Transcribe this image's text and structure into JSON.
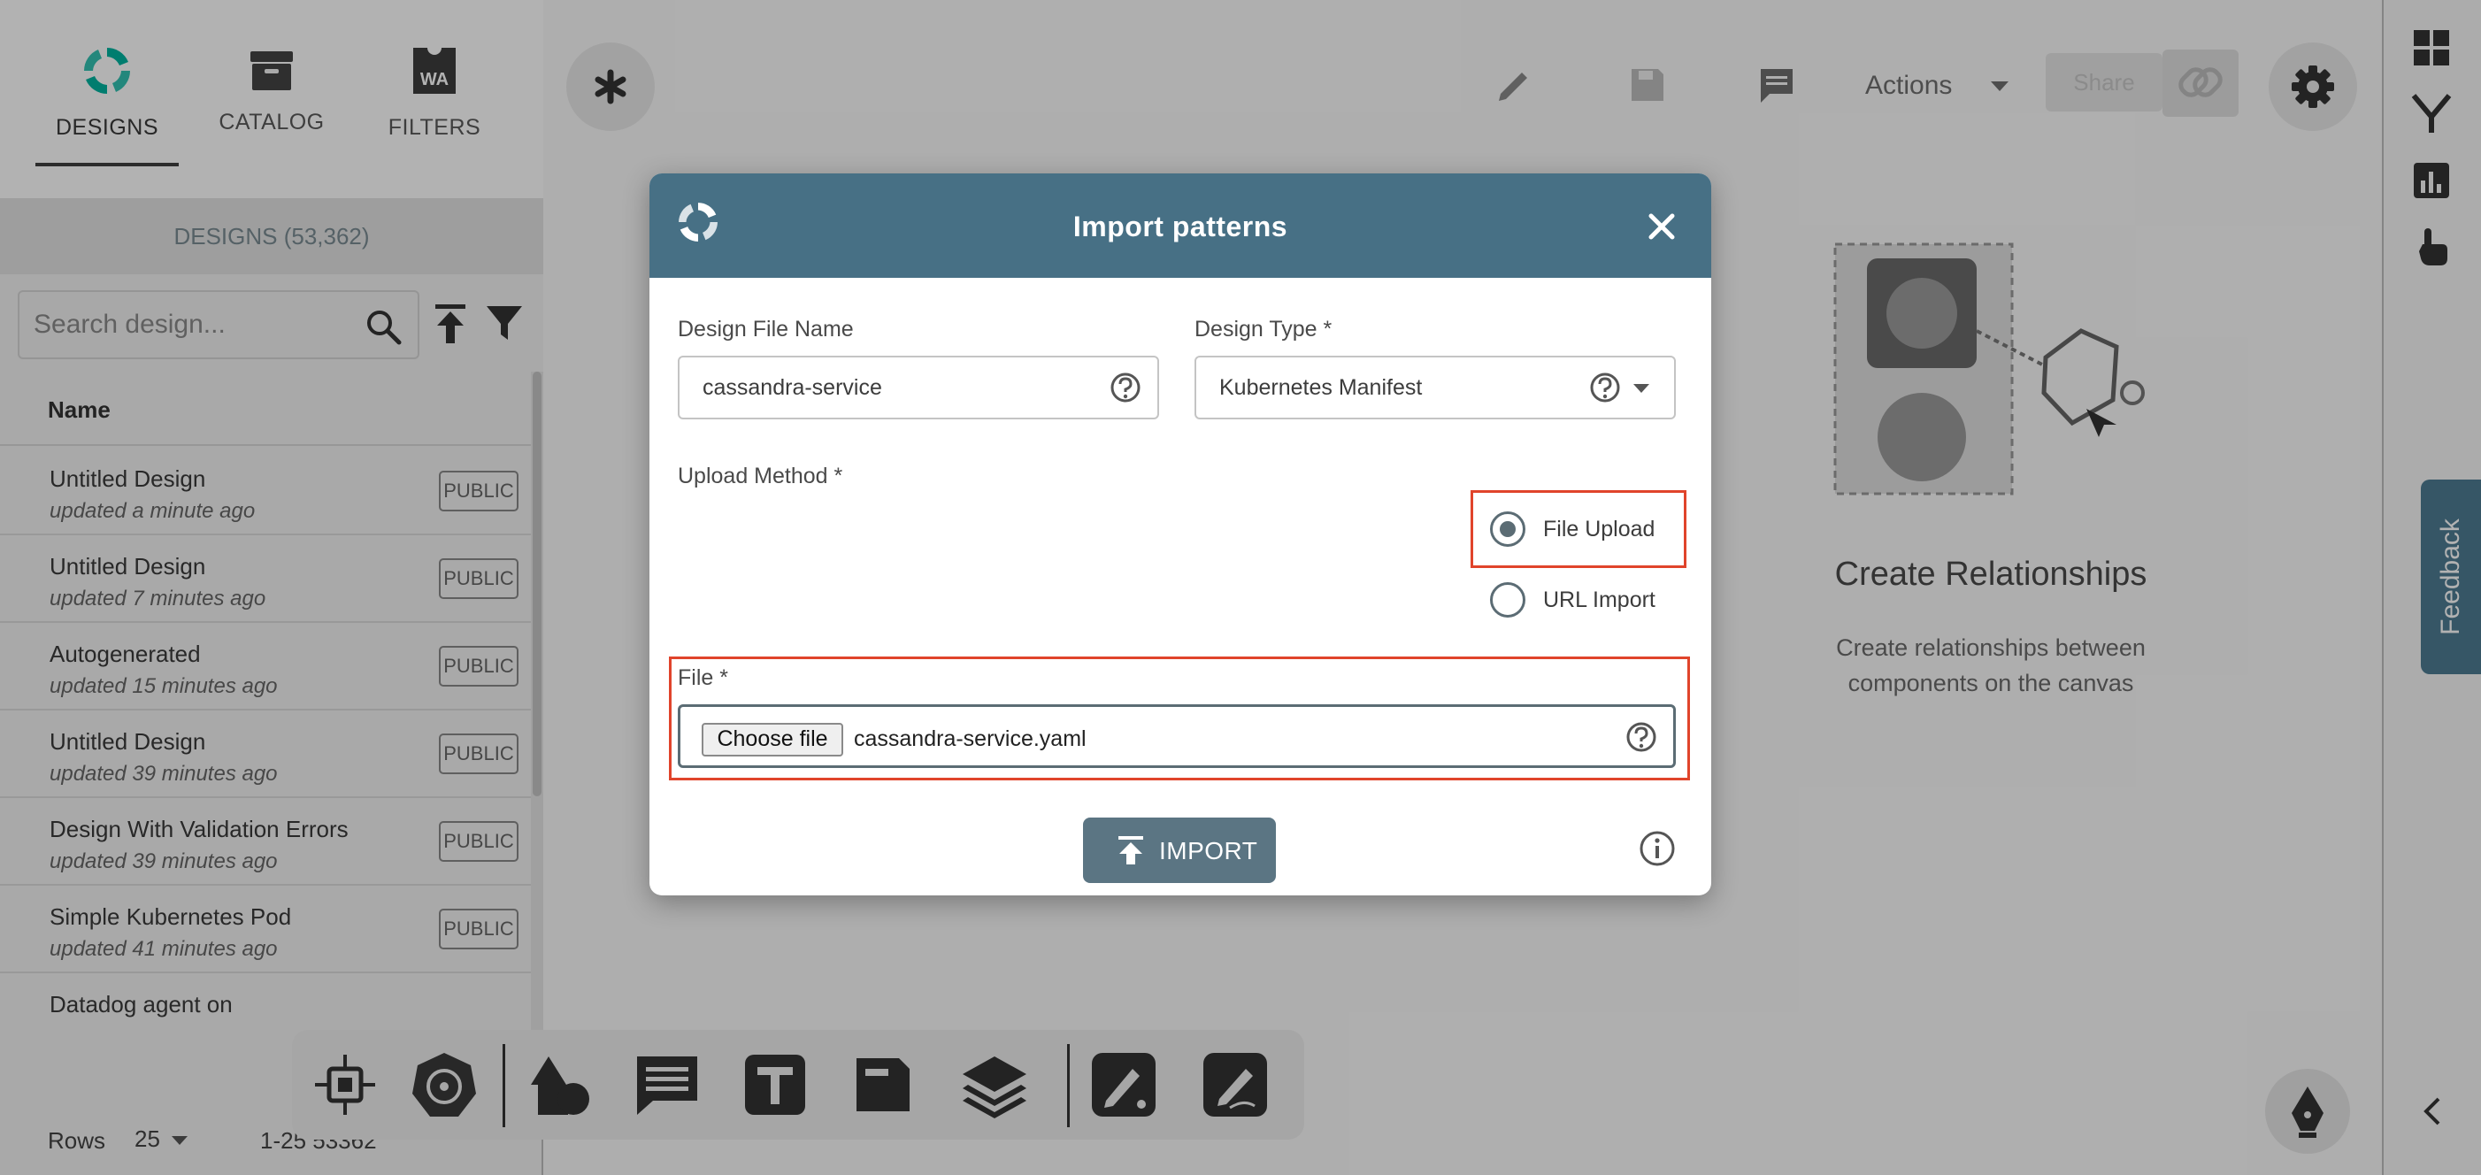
{
  "sidebar": {
    "tabs": [
      {
        "label": "DESIGNS",
        "icon": "designs-icon"
      },
      {
        "label": "CATALOG",
        "icon": "catalog-icon"
      },
      {
        "label": "FILTERS",
        "icon": "filters-icon",
        "icon_text": "WA"
      }
    ],
    "designs_count": "DESIGNS (53,362)",
    "search_placeholder": "Search design...",
    "table_header": "Name",
    "rows": [
      {
        "name": "Untitled Design",
        "updated": "updated a minute ago",
        "badge": "PUBLIC"
      },
      {
        "name": "Untitled Design",
        "updated": "updated 7 minutes ago",
        "badge": "PUBLIC"
      },
      {
        "name": "Autogenerated",
        "updated": "updated 15 minutes ago",
        "badge": "PUBLIC"
      },
      {
        "name": "Untitled Design",
        "updated": "updated 39 minutes ago",
        "badge": "PUBLIC"
      },
      {
        "name": "Design With Validation Errors",
        "updated": "updated 39 minutes ago",
        "badge": "PUBLIC"
      },
      {
        "name": "Simple Kubernetes Pod",
        "updated": "updated 41 minutes ago",
        "badge": "PUBLIC"
      },
      {
        "name": "Datadog agent on",
        "updated": "",
        "badge": ""
      }
    ],
    "pagination": {
      "rows_label": "Rows",
      "rows_value": "25",
      "range": "1-25 53362"
    }
  },
  "toolbar": {
    "actions_label": "Actions",
    "share_label": "Share"
  },
  "help_card": {
    "title": "Create Relationships",
    "description": "Create relationships between components on the canvas"
  },
  "feedback_label": "Feedback",
  "modal": {
    "title": "Import patterns",
    "design_file_name_label": "Design File Name",
    "design_file_name_value": "cassandra-service",
    "design_type_label": "Design Type *",
    "design_type_value": "Kubernetes Manifest",
    "upload_method_label": "Upload Method *",
    "upload_options": [
      {
        "label": "File Upload",
        "checked": true
      },
      {
        "label": "URL Import",
        "checked": false
      }
    ],
    "file_label": "File *",
    "choose_file_label": "Choose file",
    "file_name": "cassandra-service.yaml",
    "import_label": "IMPORT"
  },
  "colors": {
    "modal_header": "#477085",
    "accent": "#5b7583",
    "highlight": "#e0442b",
    "brand_green": "#00b39f",
    "feedback": "#4e7c93"
  }
}
